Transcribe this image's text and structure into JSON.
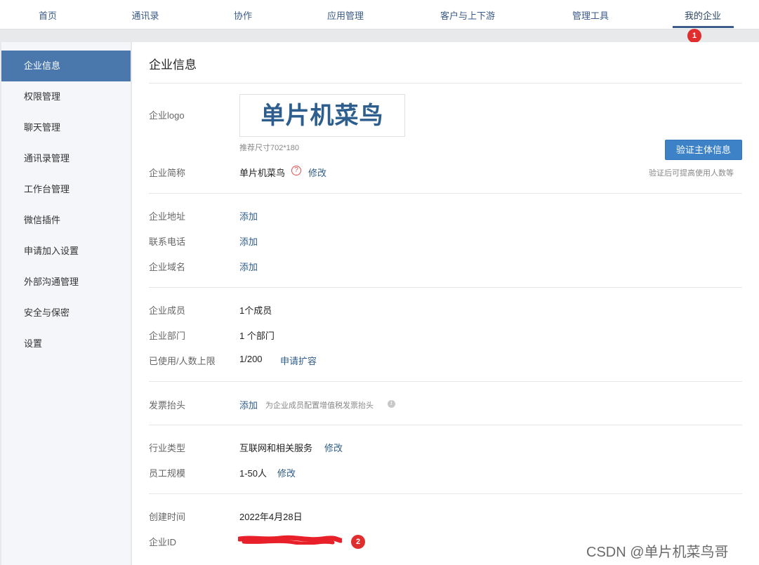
{
  "nav": {
    "items": [
      "首页",
      "通讯录",
      "协作",
      "应用管理",
      "客户与上下游",
      "管理工具",
      "我的企业"
    ],
    "active": "我的企业",
    "badge": "1"
  },
  "sidebar": {
    "items": [
      "企业信息",
      "权限管理",
      "聊天管理",
      "通讯录管理",
      "工作台管理",
      "微信插件",
      "申请加入设置",
      "外部沟通管理",
      "安全与保密",
      "设置"
    ],
    "active": "企业信息"
  },
  "main": {
    "title": "企业信息",
    "logo": {
      "label": "企业logo",
      "text": "单片机菜鸟",
      "size_hint": "推荐尺寸702*180"
    },
    "verify": {
      "button": "验证主体信息",
      "hint": "验证后可提高使用人数等"
    },
    "short_name": {
      "label": "企业简称",
      "value": "单片机菜鸟",
      "edit": "修改",
      "help_icon": "?"
    },
    "address": {
      "label": "企业地址",
      "action": "添加"
    },
    "phone": {
      "label": "联系电话",
      "action": "添加"
    },
    "domain": {
      "label": "企业域名",
      "action": "添加"
    },
    "members": {
      "label": "企业成员",
      "value": "1个成员"
    },
    "departments": {
      "label": "企业部门",
      "value": "1 个部门"
    },
    "usage": {
      "label": "已使用/人数上限",
      "value": "1/200",
      "action": "申请扩容"
    },
    "invoice": {
      "label": "发票抬头",
      "action": "添加",
      "hint": "为企业成员配置增值税发票抬头",
      "info_icon": "i"
    },
    "industry": {
      "label": "行业类型",
      "value": "互联网和相关服务",
      "edit": "修改"
    },
    "scale": {
      "label": "员工规模",
      "value": "1-50人",
      "edit": "修改"
    },
    "created": {
      "label": "创建时间",
      "value": "2022年4月28日"
    },
    "corp_id": {
      "label": "企业ID",
      "badge": "2"
    }
  },
  "watermark": "CSDN @单片机菜鸟哥",
  "colors": {
    "accent": "#4a78ad",
    "button": "#3d82c6",
    "link": "#2f5c8a",
    "badge": "#e02e2e",
    "redaction": "#e8202a"
  }
}
